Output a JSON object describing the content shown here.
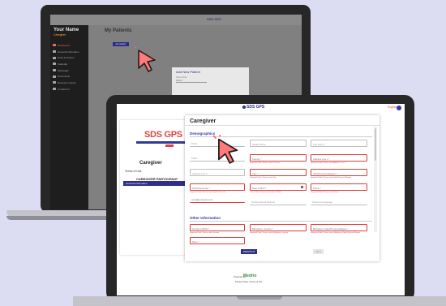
{
  "back_screen": {
    "logo": "SDS GPS",
    "user_name": "Your Name",
    "user_subtitle": "Caregiver",
    "nav": [
      {
        "label": "Dashboard",
        "active": true
      },
      {
        "label": "General Information",
        "active": false
      },
      {
        "label": "Tools & Actions",
        "active": false
      },
      {
        "label": "Calendar",
        "active": false
      },
      {
        "label": "Messages",
        "active": false
      },
      {
        "label": "Documents",
        "active": false
      },
      {
        "label": "Resource Center",
        "active": false
      },
      {
        "label": "Contact Us",
        "active": false
      }
    ],
    "page_title": "My Patients",
    "add_button": "ADD PATIENT",
    "modal": {
      "title": "Add New Patient",
      "field_label": "Patient Role",
      "select_value": "Patient"
    }
  },
  "front_screen": {
    "logo": "SDS GPS",
    "language": "English",
    "left_panel": {
      "brand": "SDS GPS",
      "title": "Caregiver",
      "terms": "Terms of Use",
      "participant": "CAREGIVER PARTICIPANT",
      "active_step": "General Information"
    },
    "form": {
      "title": "Caregiver",
      "section1": "Demographics",
      "section2": "Other Information",
      "fields": {
        "prefix": "Prefix",
        "first_name": "First Name *",
        "middle_name": "Middle Name",
        "last_name": "Last Name *",
        "suffix": "Suffix",
        "country": "Country *",
        "address1": "Address Line 1 *",
        "address2": "Address Line 2",
        "city": "City *",
        "state": "State/Province/Region *",
        "zip": "Zip/Postal Code *",
        "dob": "Date of Birth *",
        "phone": "Phone *",
        "email": "email@example.com",
        "alt_email": "Optional Email Address",
        "language": "Preferred Language",
        "gender": "Gender At Birth *",
        "birth_country": "Birthplace: Country *",
        "birth_state": "Birthplace: State/Province/Region *",
        "other": "Race *"
      },
      "hints": {
        "country": "Required Field. Please select Country",
        "address1": "Required Field. Please enter Address Line 1",
        "city": "Required Field. Please enter City",
        "state": "Required Field. Please enter State/Province/Region",
        "zip": "Required Field. Please enter Zip/Postal Code",
        "dob": "Date of Birth. Please enter Date of Birth",
        "phone": "Required Field. Please enter Phone",
        "first_name": "Required Field. Please enter First Name",
        "last_name": "Required Field. Please enter Last Name",
        "gender": "Required Field. Please select Gender",
        "birth_country": "Required Field. Please select Birthplace Country",
        "birth_state": "Required Field. Please select Birthplace State/Province/Region"
      },
      "previous_button": "PREVIOUS",
      "next_button": "NEXT"
    },
    "footer": {
      "powered": "Powered by",
      "vendor": "Medrio",
      "links": "Privacy Policy  |  Terms of Use"
    }
  },
  "colors": {
    "navy": "#2d2f8a",
    "red": "#e03a3a",
    "cursor": "#ff6b6b"
  }
}
